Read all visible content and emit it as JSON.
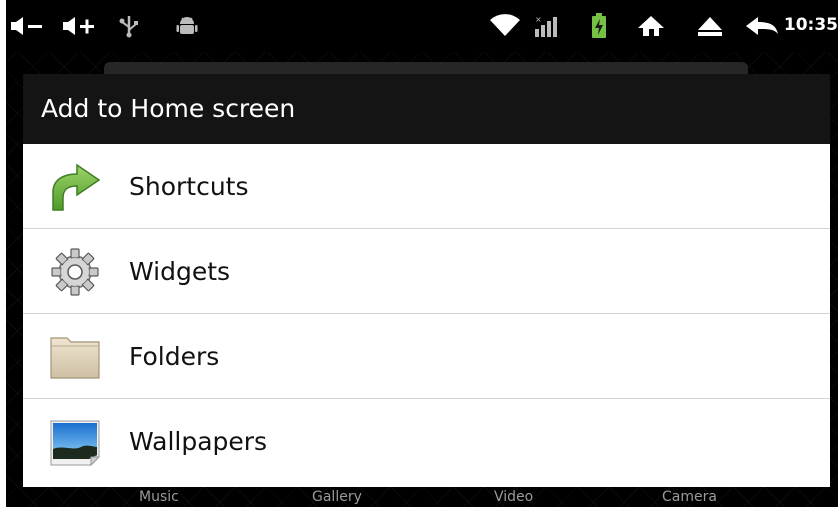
{
  "status_bar": {
    "time": "10:35",
    "icons": [
      "volume-down-icon",
      "volume-up-icon",
      "usb-icon",
      "android-debug-icon",
      "wifi-icon",
      "signal-icon",
      "battery-charging-icon",
      "home-icon",
      "eject-icon",
      "back-icon"
    ]
  },
  "dialog": {
    "title": "Add to Home screen",
    "items": [
      {
        "label": "Shortcuts",
        "icon": "shortcut-arrow-icon"
      },
      {
        "label": "Widgets",
        "icon": "gear-icon"
      },
      {
        "label": "Folders",
        "icon": "folder-icon"
      },
      {
        "label": "Wallpapers",
        "icon": "wallpaper-icon"
      }
    ]
  },
  "dock": {
    "labels": [
      "Music",
      "Gallery",
      "Video",
      "Camera"
    ]
  },
  "colors": {
    "title_bar": "#141414",
    "divider": "#d4d4d4",
    "accent_green": "#6fb33c"
  }
}
